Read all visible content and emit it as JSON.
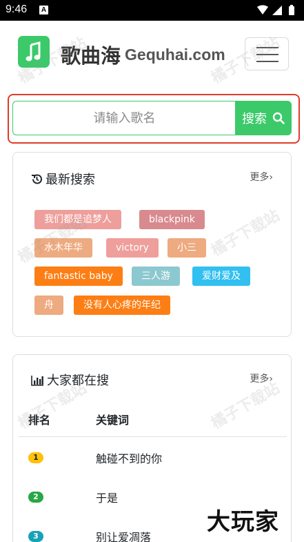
{
  "status_bar": {
    "time": "9:46",
    "notification": "A"
  },
  "header": {
    "app_name": "歌曲海",
    "domain_text": "Gequhai.com"
  },
  "search": {
    "placeholder": "请输入歌名",
    "button_label": "搜索"
  },
  "recent": {
    "title": "最新搜索",
    "more_label": "更多›",
    "tags": [
      {
        "label": "我们都是追梦人",
        "color": "#ee9f9b"
      },
      {
        "label": "blackpink",
        "color": "#d88a8e"
      },
      {
        "label": "水木年华",
        "color": "#eeaa80"
      },
      {
        "label": "victory",
        "color": "#ee9f9b"
      },
      {
        "label": "小三",
        "color": "#eeaa80"
      },
      {
        "label": "fantastic baby",
        "color": "#fd7e14"
      },
      {
        "label": "三人游",
        "color": "#8cc8cf"
      },
      {
        "label": "爱财爱及",
        "color": "#31c0f0"
      },
      {
        "label": "舟",
        "color": "#eeaa80"
      },
      {
        "label": "没有人心疼的年纪",
        "color": "#fd7e14"
      }
    ]
  },
  "popular": {
    "title": "大家都在搜",
    "more_label": "更多›",
    "col_rank": "排名",
    "col_keyword": "关键词",
    "rows": [
      {
        "rank": "1",
        "song": "触碰不到的你",
        "badge_color": "#ffc107"
      },
      {
        "rank": "2",
        "song": "于是",
        "badge_color": "#28a745"
      },
      {
        "rank": "3",
        "song": "别让爱凋落",
        "badge_color": "#17a2b8"
      }
    ]
  },
  "watermark": "橘子下载站",
  "site_mark": "大玩家",
  "colors": {
    "brand_green": "#3cc96a",
    "highlight_red": "#e03b2a"
  }
}
